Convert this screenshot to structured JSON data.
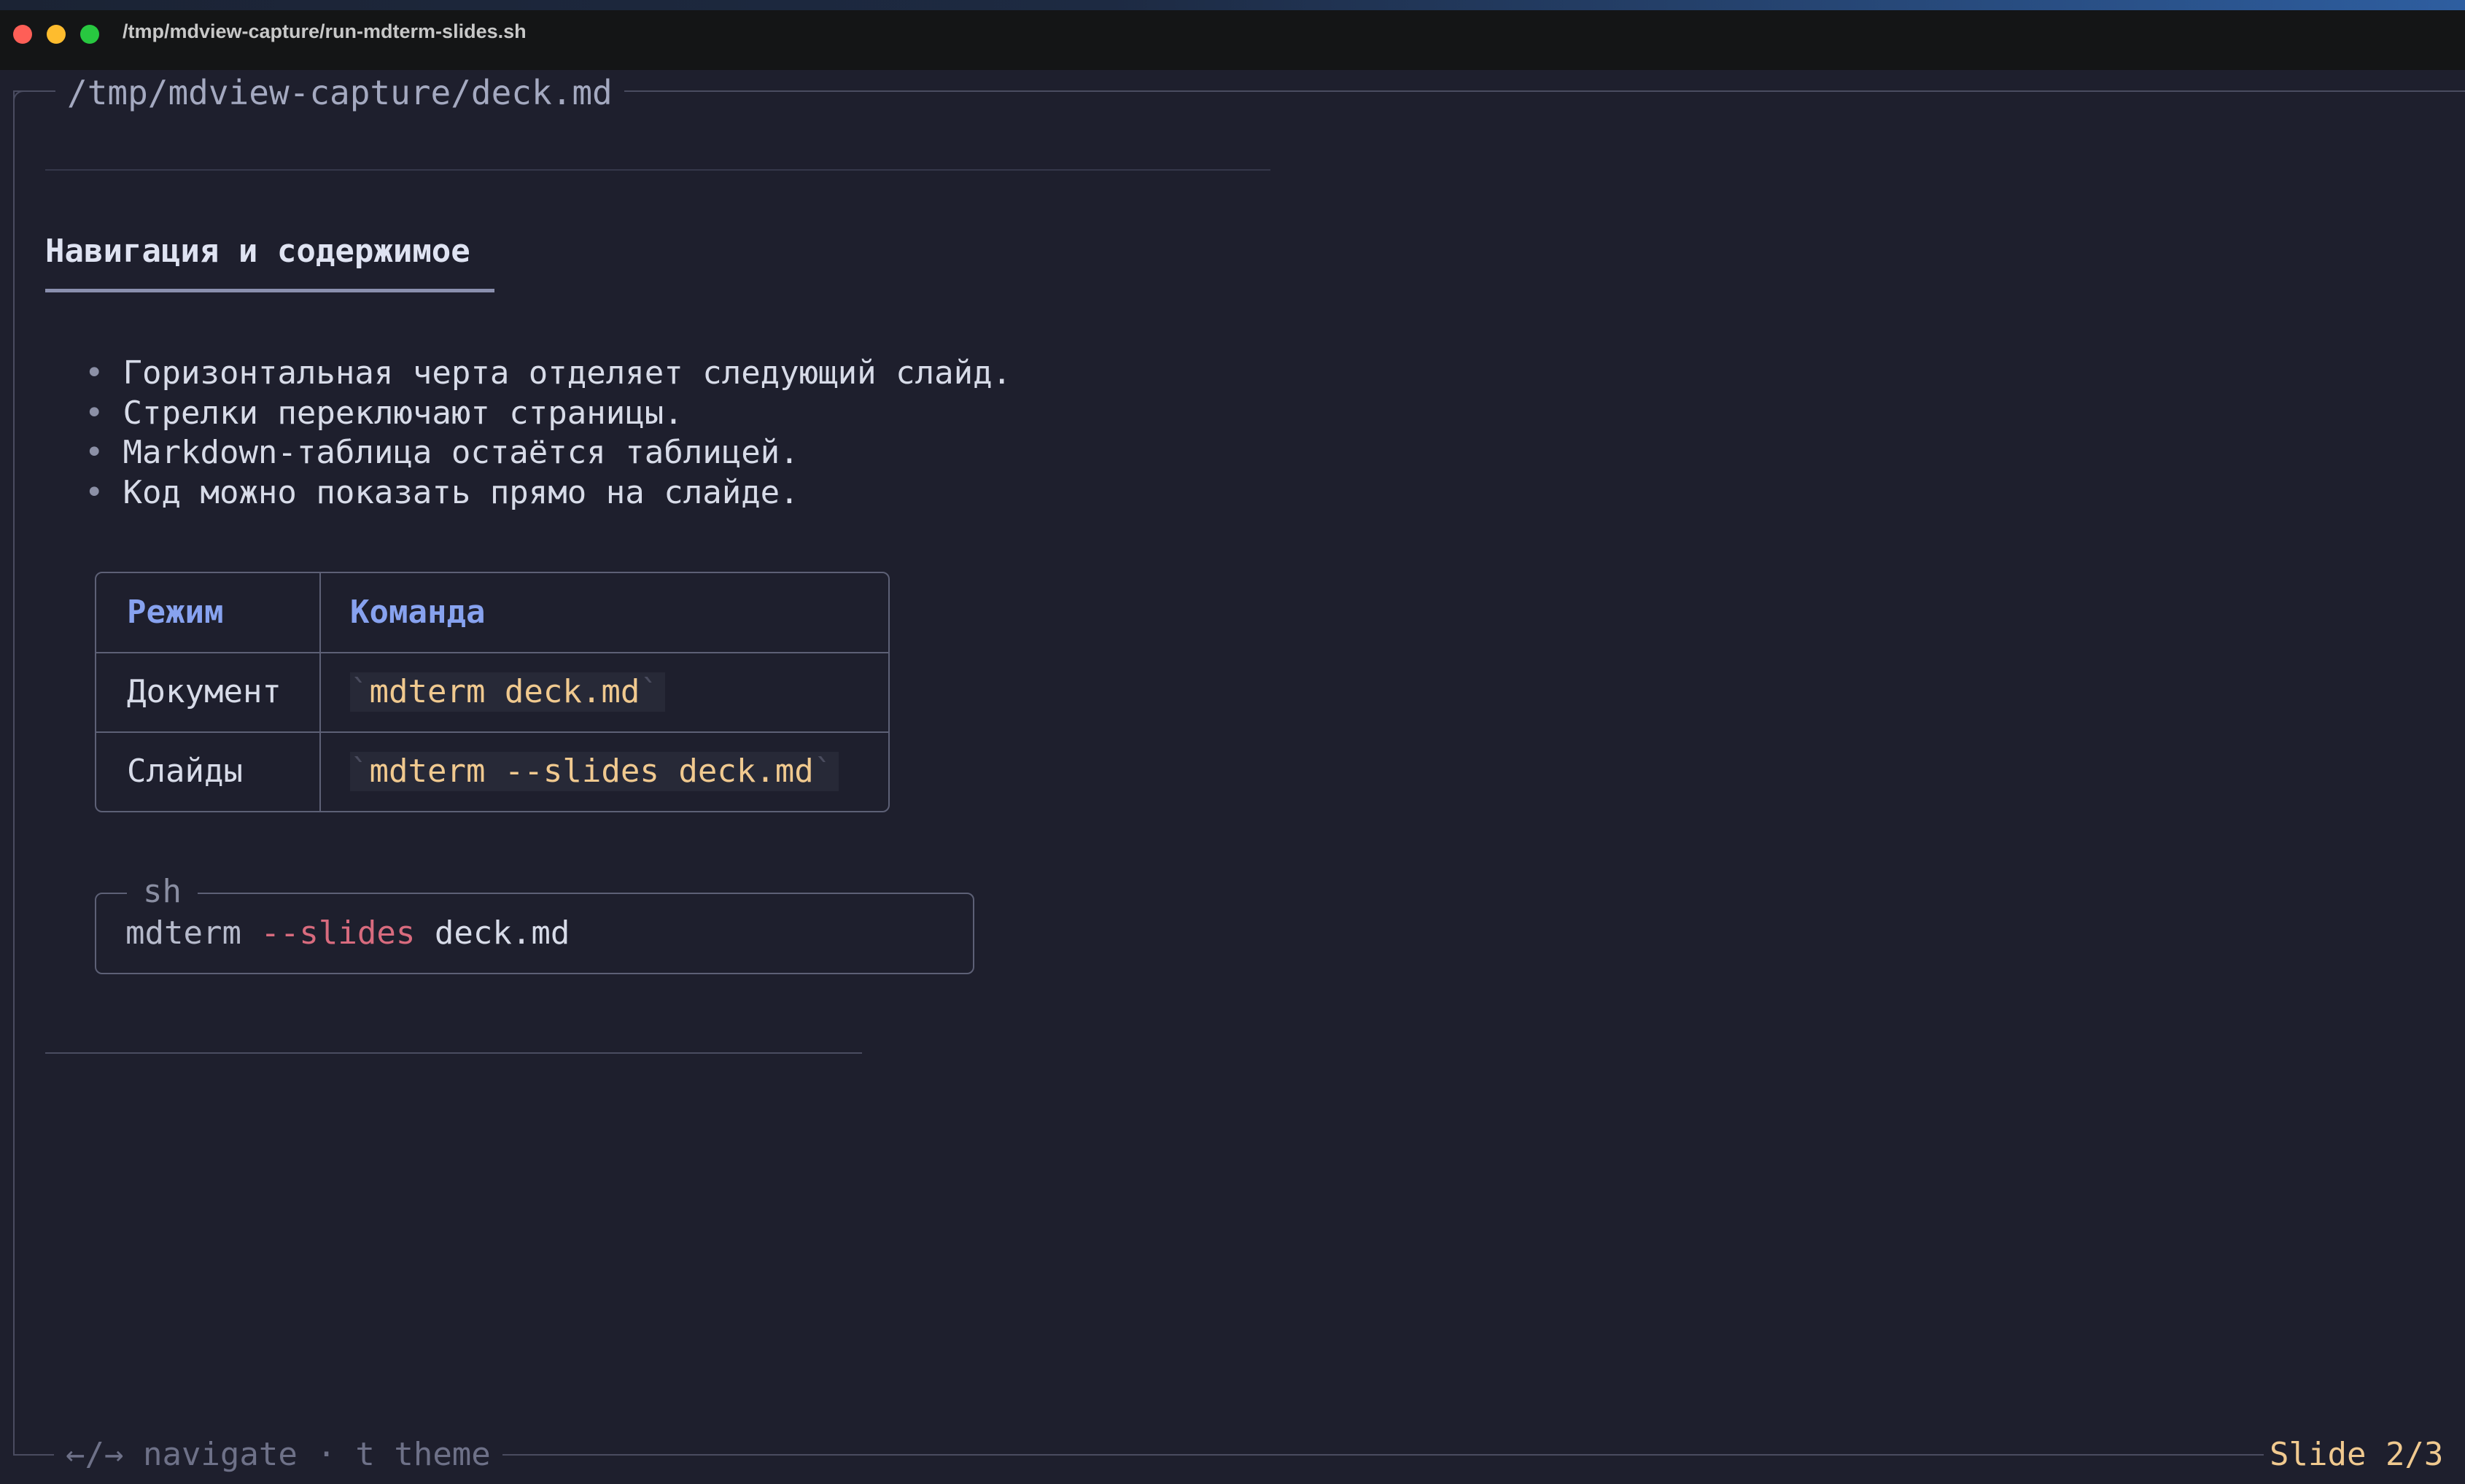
{
  "window": {
    "title": "/tmp/mdview-capture/run-mdterm-slides.sh"
  },
  "document": {
    "file_path": "/tmp/mdview-capture/deck.md"
  },
  "slide": {
    "heading": "Навигация и содержимое",
    "bullet_marker": "•",
    "bullets": [
      "Горизонтальная черта отделяет следующий слайд.",
      "Стрелки переключают страницы.",
      "Markdown-таблица остаётся таблицей.",
      "Код можно показать прямо на слайде."
    ],
    "table": {
      "headers": [
        "Режим",
        "Команда"
      ],
      "rows": [
        {
          "mode": "Документ",
          "command": "mdterm deck.md"
        },
        {
          "mode": "Слайды",
          "command": "mdterm --slides deck.md"
        }
      ],
      "code_tick": "`"
    },
    "code_block": {
      "language": "sh",
      "tokens": {
        "command": "mdterm",
        "flag": "--slides",
        "argument": "deck.md"
      }
    }
  },
  "footer": {
    "hint": "←/→ navigate · t theme",
    "slide_counter": "Slide 2/3"
  },
  "colors": {
    "background": "#1e1f2d",
    "table_header": "#87a2ef",
    "inline_code": "#f0c98f",
    "flag": "#d86b7e",
    "slide_counter": "#f0c98f"
  }
}
